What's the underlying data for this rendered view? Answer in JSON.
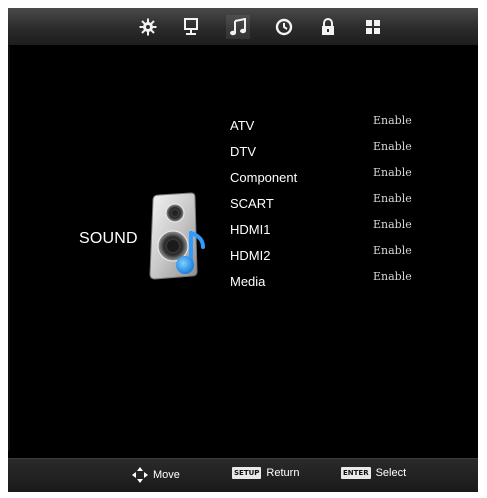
{
  "topbar": {
    "tabs": [
      {
        "icon": "gear-icon",
        "name": "picture"
      },
      {
        "icon": "monitor-icon",
        "name": "screen"
      },
      {
        "icon": "music-note-icon",
        "name": "sound"
      },
      {
        "icon": "clock-icon",
        "name": "time"
      },
      {
        "icon": "lock-icon",
        "name": "lock"
      },
      {
        "icon": "grid-icon",
        "name": "setup"
      }
    ]
  },
  "section": {
    "title": "SOUND",
    "icon": "speaker-icon"
  },
  "menu": {
    "items": [
      {
        "label": "ATV",
        "value": "Enable"
      },
      {
        "label": "DTV",
        "value": "Enable"
      },
      {
        "label": "Component",
        "value": "Enable"
      },
      {
        "label": "SCART",
        "value": "Enable"
      },
      {
        "label": "HDMI1",
        "value": "Enable"
      },
      {
        "label": "HDMI2",
        "value": "Enable"
      },
      {
        "label": "Media",
        "value": "Enable"
      }
    ]
  },
  "footer": {
    "move_label": "Move",
    "setup_key": "SETUP",
    "return_label": "Return",
    "enter_key": "ENTER",
    "select_label": "Select"
  },
  "colors": {
    "background": "#000000",
    "text": "#ffffff",
    "value_text": "#d6d6d6",
    "accent_blue": "#2f9bff"
  }
}
